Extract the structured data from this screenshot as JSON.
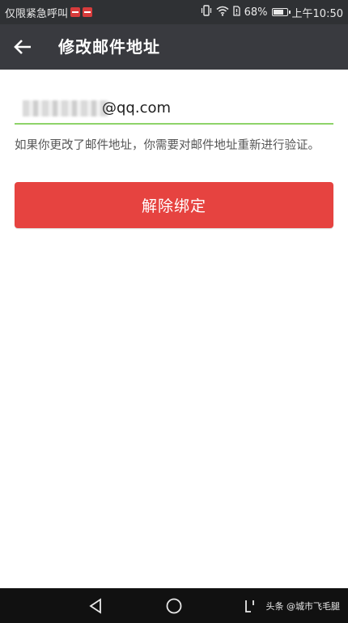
{
  "status_bar": {
    "carrier_text": "仅限紧急呼叫",
    "battery_percent": "68%",
    "battery_level": 0.68,
    "time": "上午10:50"
  },
  "app_bar": {
    "title": "修改邮件地址",
    "back_icon": "arrow-left-icon"
  },
  "form": {
    "email_value": "@qq.com",
    "hint": "如果你更改了邮件地址，你需要对邮件地址重新进行验证。",
    "unbind_label": "解除绑定",
    "underline_color": "#8ed36a",
    "button_color": "#e64340"
  },
  "nav_bar": {
    "back_icon": "triangle-back-icon",
    "home_icon": "circle-home-icon",
    "recent_icon": "bracket-recent-icon",
    "watermark": "头条 @城市飞毛腿"
  }
}
